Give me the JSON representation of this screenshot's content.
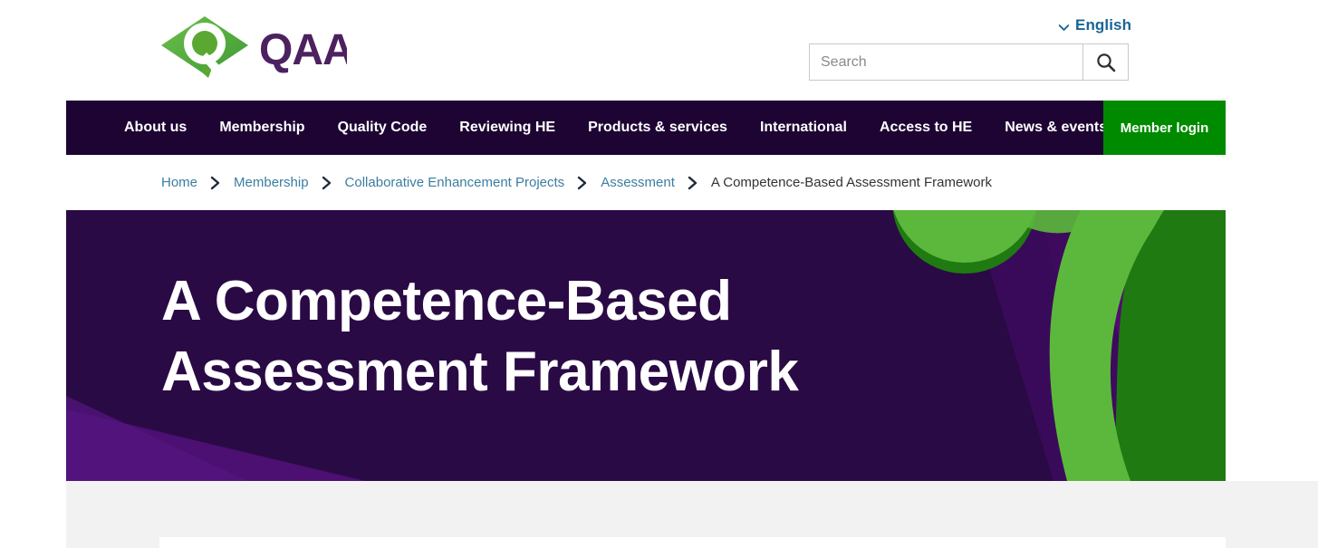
{
  "site": {
    "brand_name": "QAA",
    "logo_icon": "qaa-diamond-logo",
    "brand_purple": "#4d2160",
    "brand_green": "#5aa832"
  },
  "header": {
    "language": {
      "label": "English",
      "icon": "chevron-down-icon",
      "color": "#1a6496"
    },
    "search": {
      "placeholder": "Search",
      "value": "",
      "button_icon": "search-icon"
    }
  },
  "nav": {
    "background": "#1d0433",
    "items": [
      {
        "label": "About us"
      },
      {
        "label": "Membership"
      },
      {
        "label": "Quality Code"
      },
      {
        "label": "Reviewing HE"
      },
      {
        "label": "Products & services"
      },
      {
        "label": "International"
      },
      {
        "label": "Access to HE"
      },
      {
        "label": "News & events"
      }
    ],
    "login": {
      "label": "Member login",
      "background": "#008a00"
    }
  },
  "breadcrumb": {
    "separator_icon": "chevron-right-icon",
    "items": [
      {
        "label": "Home",
        "current": false
      },
      {
        "label": "Membership",
        "current": false
      },
      {
        "label": "Collaborative Enhancement Projects",
        "current": false
      },
      {
        "label": "Assessment",
        "current": false
      },
      {
        "label": "A Competence-Based Assessment Framework",
        "current": true
      }
    ]
  },
  "hero": {
    "title": "A Competence-Based\nAssessment Framework",
    "background": "#2a0a45",
    "accent_purple": "#4c0f72",
    "accent_green_light": "#5cb83c",
    "accent_green_dark": "#1f7a12"
  }
}
